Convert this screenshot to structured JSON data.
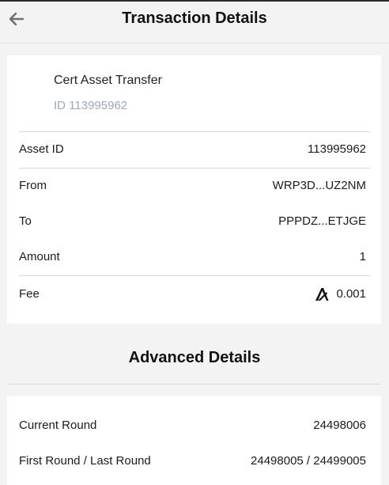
{
  "header": {
    "title": "Transaction Details"
  },
  "transaction": {
    "type_title": "Cert Asset Transfer",
    "id_text": "ID 113995962",
    "rows": [
      {
        "label": "Asset ID",
        "value": "113995962"
      },
      {
        "label": "From",
        "value": "WRP3D...UZ2NM"
      },
      {
        "label": "To",
        "value": "PPPDZ...ETJGE"
      },
      {
        "label": "Amount",
        "value": "1"
      },
      {
        "label": "Fee",
        "value": "0.001",
        "icon": "algorand-logo-icon"
      }
    ]
  },
  "advanced": {
    "title": "Advanced Details",
    "rows": [
      {
        "label": "Current Round",
        "value": "24498006"
      },
      {
        "label": "First Round / Last Round",
        "value": "24498005 / 24499005"
      }
    ]
  },
  "icons": {
    "back": "back-arrow-icon",
    "fee_currency": "algorand-logo-icon"
  }
}
